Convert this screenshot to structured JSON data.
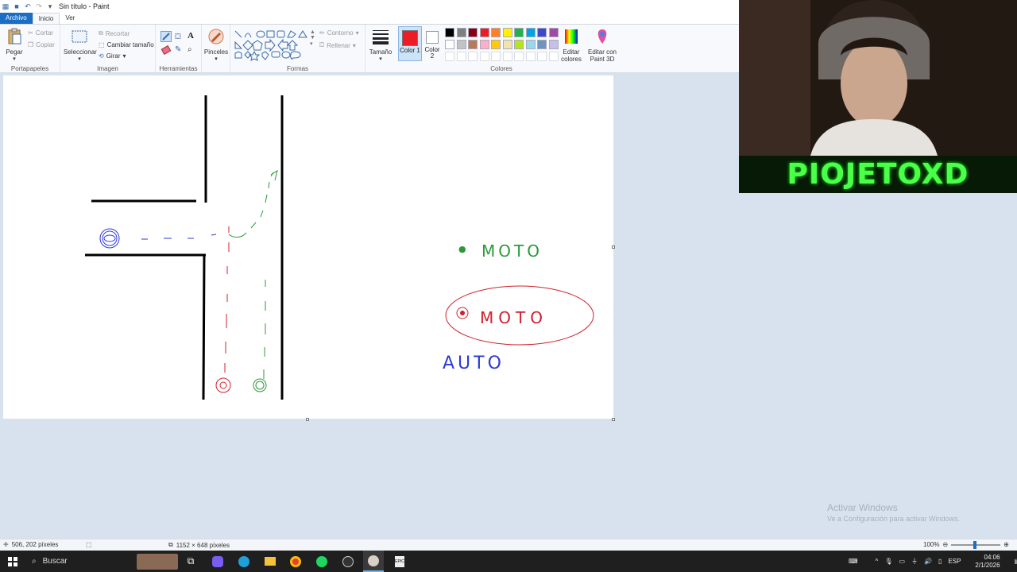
{
  "window": {
    "title": "Sin título - Paint"
  },
  "tabs": {
    "file": "Archivo",
    "home": "Inicio",
    "view": "Ver"
  },
  "ribbon": {
    "clipboard": {
      "paste": "Pegar",
      "cut": "Cortar",
      "copy": "Copiar",
      "label": "Portapapeles"
    },
    "image": {
      "select": "Seleccionar",
      "crop": "Recortar",
      "resize": "Cambiar tamaño",
      "rotate": "Girar",
      "label": "Imagen"
    },
    "tools": {
      "label": "Herramientas"
    },
    "brushes": {
      "label": "Pinceles"
    },
    "shapes": {
      "outline": "Contorno",
      "fill": "Rellenar",
      "label": "Formas"
    },
    "size": {
      "label": "Tamaño"
    },
    "color1": {
      "label": "Color 1"
    },
    "color2": {
      "label": "Color 2"
    },
    "colors": {
      "label": "Colores",
      "edit": "Editar colores"
    },
    "paint3d": {
      "label": "Editar con Paint 3D"
    }
  },
  "palette": [
    "#000000",
    "#7f7f7f",
    "#880015",
    "#ed1c24",
    "#ff7f27",
    "#fff200",
    "#22b14c",
    "#00a2e8",
    "#3f48cc",
    "#a349a4",
    "#ffffff",
    "#c3c3c3",
    "#b97a57",
    "#ffaec9",
    "#ffc90e",
    "#efe4b0",
    "#b5e61d",
    "#99d9ea",
    "#7092be",
    "#c8bfe7"
  ],
  "color1_value": "#ed1c24",
  "canvas_text": {
    "top_label": "MOTO",
    "red_label": "MOTO",
    "blue_label": "AUTO"
  },
  "statusbar": {
    "cursor": "506, 202 píxeles",
    "size": "1152 × 648 píxeles",
    "zoom": "100%"
  },
  "watermark": {
    "line1": "Activar Windows",
    "line2": "Ve a Configuración para activar Windows."
  },
  "overlay": {
    "name": "PIOJETOXD"
  },
  "taskbar": {
    "search": "Buscar",
    "lang": "ESP",
    "time": "04:06",
    "date": "2/1/2026"
  }
}
